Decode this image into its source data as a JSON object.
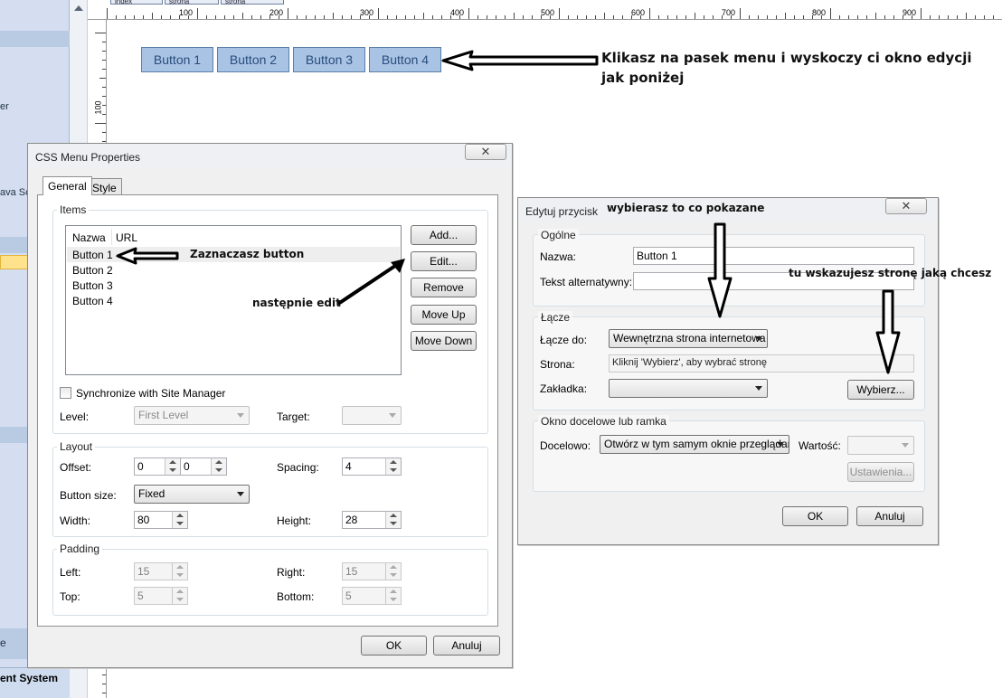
{
  "sidebar": {
    "texts": [
      "er",
      "ava Scri",
      "e",
      "ent System"
    ]
  },
  "ruler": {
    "tabs": [
      "index",
      "strona",
      "strona"
    ],
    "top_numbers": [
      "100",
      "200",
      "300",
      "400",
      "500",
      "600",
      "700",
      "800",
      "900"
    ],
    "left_number": "100"
  },
  "canvas": {
    "menu_buttons": [
      "Button 1",
      "Button 2",
      "Button 3",
      "Button 4"
    ]
  },
  "annotations": {
    "top": "Klikasz na pasek menu i wyskoczy ci okno edycji jak poniżej",
    "select_button": "Zaznaczasz button",
    "then_edit": "następnie edit",
    "choose_shown": "wybierasz to co pokazane",
    "choose_page": "tu wskazujesz stronę jaką chcesz"
  },
  "css_dialog": {
    "title": "CSS Menu Properties",
    "close": "✕",
    "tabs": [
      "General",
      "Style"
    ],
    "items_group": "Items",
    "columns": [
      "Nazwa",
      "URL"
    ],
    "items": [
      "Button 1",
      "Button 2",
      "Button 3",
      "Button 4"
    ],
    "buttons": [
      "Add...",
      "Edit...",
      "Remove",
      "Move Up",
      "Move Down"
    ],
    "sync_label": "Synchronize with Site Manager",
    "level_label": "Level:",
    "level_value": "First Level",
    "target_label": "Target:",
    "target_value": "",
    "layout_group": "Layout",
    "offset_label": "Offset:",
    "offset_x": "0",
    "offset_y": "0",
    "spacing_label": "Spacing:",
    "spacing_value": "4",
    "button_size_label": "Button size:",
    "button_size_value": "Fixed",
    "width_label": "Width:",
    "width_value": "80",
    "height_label": "Height:",
    "height_value": "28",
    "padding_group": "Padding",
    "left_label": "Left:",
    "left_value": "15",
    "right_label": "Right:",
    "right_value": "15",
    "top_label": "Top:",
    "top_value": "5",
    "bottom_label": "Bottom:",
    "bottom_value": "5",
    "ok": "OK",
    "cancel": "Anuluj"
  },
  "edit_dialog": {
    "title": "Edytuj przycisk",
    "close": "✕",
    "general_group": "Ogólne",
    "name_label": "Nazwa:",
    "name_value": "Button 1",
    "alt_label": "Tekst alternatywny:",
    "alt_value": "",
    "link_group": "Łącze",
    "link_to_label": "Łącze do:",
    "link_to_value": "Wewnętrzna strona internetowa",
    "page_label": "Strona:",
    "page_value": "Kliknij 'Wybierz', aby wybrać stronę",
    "bookmark_label": "Zakładka:",
    "bookmark_value": "",
    "choose_button": "Wybierz...",
    "target_group": "Okno docelowe lub ramka",
    "target_label": "Docelowo:",
    "target_value": "Otwórz w tym samym oknie przeglądarki",
    "value_label": "Wartość:",
    "value_value": "",
    "settings_button": "Ustawienia...",
    "ok": "OK",
    "cancel": "Anuluj"
  }
}
